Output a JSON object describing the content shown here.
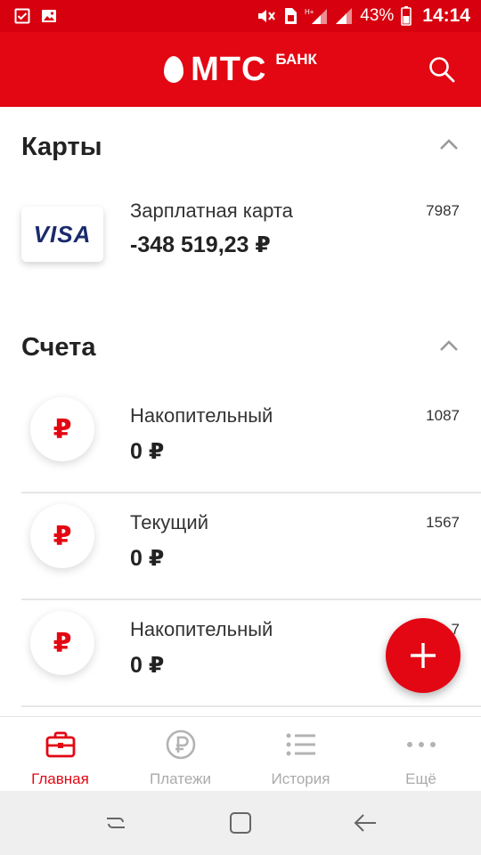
{
  "status_bar": {
    "battery_percent": "43%",
    "time": "14:14"
  },
  "header": {
    "logo_main": "МТС",
    "logo_sub": "БАНК"
  },
  "cards_section": {
    "title": "Карты",
    "items": [
      {
        "brand": "VISA",
        "name": "Зарплатная карта",
        "amount": "-348 519,23 ₽",
        "number": "7987"
      }
    ]
  },
  "accounts_section": {
    "title": "Счета",
    "items": [
      {
        "icon_glyph": "₽",
        "name": "Накопительный",
        "amount": "0 ₽",
        "number": "1087"
      },
      {
        "icon_glyph": "₽",
        "name": "Текущий",
        "amount": "0 ₽",
        "number": "1567"
      },
      {
        "icon_glyph": "₽",
        "name": "Накопительный",
        "amount": "0 ₽",
        "number": "7"
      }
    ]
  },
  "bottom_nav": {
    "items": [
      {
        "label": "Главная",
        "icon": "briefcase-icon",
        "active": true
      },
      {
        "label": "Платежи",
        "icon": "ruble-circle-icon",
        "active": false
      },
      {
        "label": "История",
        "icon": "list-icon",
        "active": false
      },
      {
        "label": "Ещё",
        "icon": "more-dots-icon",
        "active": false
      }
    ]
  },
  "colors": {
    "brand_red": "#e30613",
    "status_bar_red": "#d7000f",
    "inactive_gray": "#aaaaaa"
  }
}
